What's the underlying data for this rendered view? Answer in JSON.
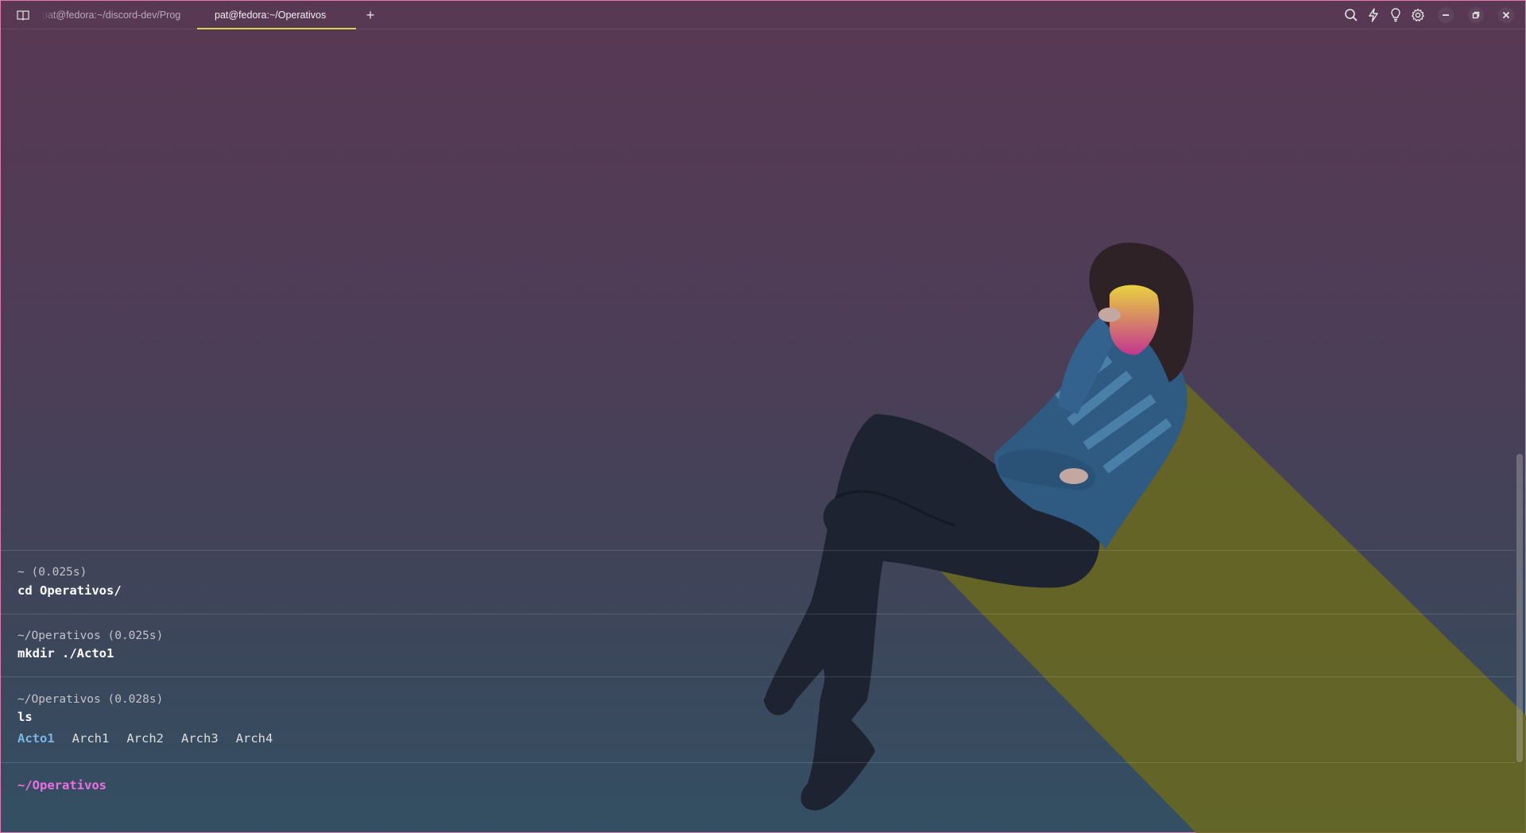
{
  "titlebar": {
    "tabs": [
      {
        "label": "pat@fedora:~/discord-dev/Prog",
        "active": false
      },
      {
        "label": "pat@fedora:~/Operativos",
        "active": true
      }
    ],
    "new_tab_label": "+",
    "icons": [
      "sidebar-icon",
      "search-icon",
      "lightning-icon",
      "lightbulb-icon",
      "gear-icon",
      "minimize-icon",
      "restore-icon",
      "close-icon"
    ]
  },
  "terminal": {
    "blocks": [
      {
        "meta": "~ (0.025s)",
        "command": "cd Operativos/"
      },
      {
        "meta": "~/Operativos (0.025s)",
        "command": "mkdir ./Acto1"
      },
      {
        "meta": "~/Operativos (0.028s)",
        "command": "ls",
        "output": {
          "dir": "Acto1",
          "files": [
            "Arch1",
            "Arch2",
            "Arch3",
            "Arch4"
          ]
        }
      }
    ],
    "prompt": "~/Operativos"
  },
  "colors": {
    "accent_tab": "#d8d650",
    "prompt": "#ee6fe4",
    "directory": "#76b7e8",
    "window_border": "#e07ab0"
  }
}
